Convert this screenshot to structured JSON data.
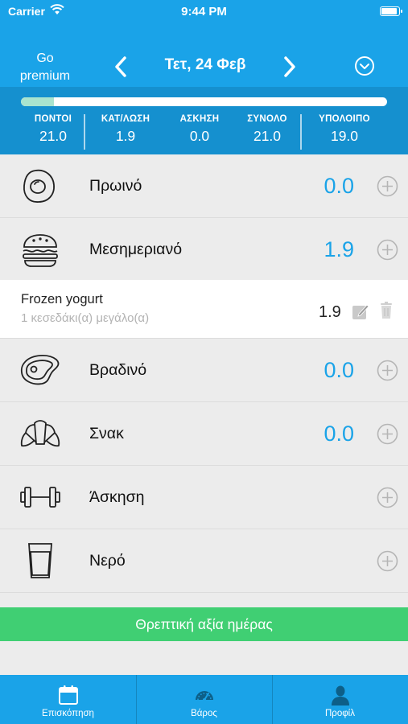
{
  "status_bar": {
    "carrier": "Carrier",
    "time": "9:44 PM"
  },
  "header": {
    "go_premium_line1": "Go",
    "go_premium_line2": "premium",
    "date": "Τετ, 24 Φεβ"
  },
  "stats": {
    "progress_fraction": 0.09,
    "progress_color": "#a9e4cf",
    "items": [
      {
        "label": "ΠΟΝΤΟΙ",
        "value": "21.0"
      },
      {
        "label": "ΚΑΤ/ΛΩΣΗ",
        "value": "1.9"
      },
      {
        "label": "ΑΣΚΗΣΗ",
        "value": "0.0"
      },
      {
        "label": "ΣΥΝΟΛΟ",
        "value": "21.0"
      },
      {
        "label": "ΥΠΟΛΟΙΠΟ",
        "value": "19.0"
      }
    ]
  },
  "meals": {
    "breakfast": {
      "label": "Πρωινό",
      "value": "0.0",
      "icon": "egg-icon"
    },
    "lunch": {
      "label": "Μεσημεριανό",
      "value": "1.9",
      "icon": "burger-icon"
    },
    "dinner": {
      "label": "Βραδινό",
      "value": "0.0",
      "icon": "steak-icon"
    },
    "snack": {
      "label": "Σνακ",
      "value": "0.0",
      "icon": "croissant-icon"
    },
    "exercise": {
      "label": "Άσκηση",
      "icon": "dumbbell-icon"
    },
    "water": {
      "label": "Νερό",
      "icon": "water-glass-icon"
    }
  },
  "food_entry": {
    "name": "Frozen yogurt",
    "portion": "1 κεσεδάκι(α) μεγάλο(α)",
    "value": "1.9",
    "edit_icon": "edit-icon",
    "delete_icon": "trash-icon"
  },
  "nutrition_button": {
    "label": "Θρεπτική αξία ημέρας",
    "color": "#40cf73"
  },
  "tabbar": {
    "color": "#1aa3e8",
    "tabs": [
      {
        "label": "Επισκόπηση",
        "icon": "calendar-icon"
      },
      {
        "label": "Βάρος",
        "icon": "scale-gauge-icon"
      },
      {
        "label": "Προφίλ",
        "icon": "profile-icon"
      }
    ]
  },
  "colors": {
    "accent": "#1aa3e8",
    "accent_dark": "#1590cf",
    "value_blue": "#1aa3e8"
  }
}
